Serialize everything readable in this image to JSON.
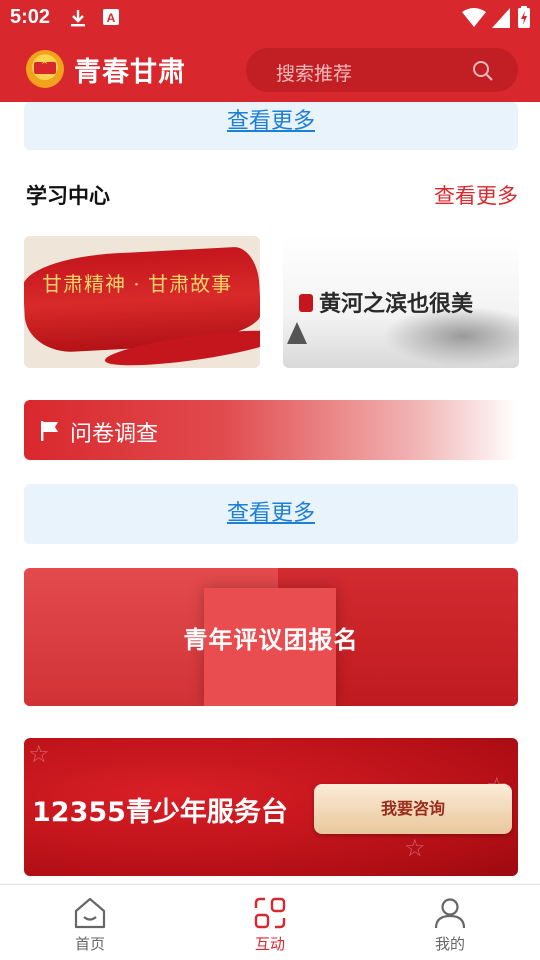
{
  "status_bar": {
    "time": "5:02"
  },
  "header": {
    "app_title": "青春甘肃",
    "search_placeholder": "搜索推荐"
  },
  "top_more": {
    "label": "查看更多"
  },
  "study_center": {
    "title": "学习中心",
    "more_label": "查看更多",
    "items": [
      {
        "caption": "甘肃精神 · 甘肃故事"
      },
      {
        "caption": "黄河之滨也很美"
      }
    ]
  },
  "survey": {
    "label": "问卷调查",
    "more_label": "查看更多"
  },
  "banners": [
    {
      "text": "青年评议团报名"
    },
    {
      "text": "12355青少年服务台",
      "cta": "我要咨询"
    }
  ],
  "bottom_nav": {
    "items": [
      {
        "label": "首页",
        "icon": "home-icon",
        "active": false
      },
      {
        "label": "互动",
        "icon": "interact-icon",
        "active": true
      },
      {
        "label": "我的",
        "icon": "person-icon",
        "active": false
      }
    ]
  },
  "colors": {
    "brand_red": "#d9282d",
    "link_blue": "#1e7fd6",
    "more_bg": "#e8f3fc"
  }
}
